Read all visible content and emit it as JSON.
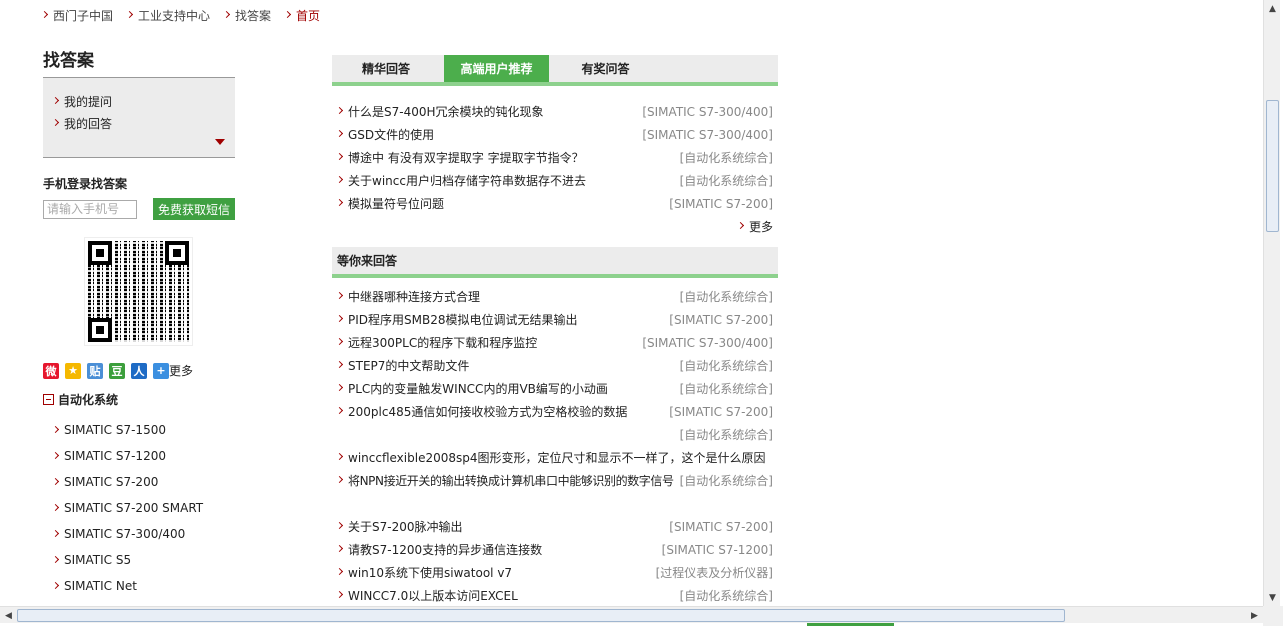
{
  "breadcrumb": [
    "西门子中国",
    "工业支持中心",
    "找答案",
    "首页"
  ],
  "left": {
    "title": "找答案",
    "my_links": [
      "我的提问",
      "我的回答"
    ],
    "mobile_title": "手机登录找答案",
    "phone_placeholder": "请输入手机号",
    "sms_button": "免费获取短信",
    "share_more": "更多",
    "category_title": "自动化系统",
    "categories": [
      "SIMATIC S7-1500",
      "SIMATIC S7-1200",
      "SIMATIC S7-200",
      "SIMATIC S7-200 SMART",
      "SIMATIC S7-300/400",
      "SIMATIC S5",
      "SIMATIC Net"
    ]
  },
  "tabs": [
    "精华回答",
    "高端用户推荐",
    "有奖问答"
  ],
  "featured": [
    {
      "q": "什么是S7-400H冗余模块的钝化现象",
      "c": "[SIMATIC S7-300/400]"
    },
    {
      "q": "GSD文件的使用",
      "c": "[SIMATIC S7-300/400]"
    },
    {
      "q": "博途中  有没有双字提取字  字提取字节指令？",
      "c": "[自动化系统综合]"
    },
    {
      "q": "关于wincc用户归档存储字符串数据存不进去",
      "c": "[自动化系统综合]"
    },
    {
      "q": "模拟量符号位问题",
      "c": "[SIMATIC S7-200]"
    }
  ],
  "more_label": "更多",
  "wait_title": "等你来回答",
  "waiting": [
    {
      "q": "中继器哪种连接方式合理",
      "c": "[自动化系统综合]"
    },
    {
      "q": "PID程序用SMB28模拟电位调试无结果输出",
      "c": "[SIMATIC S7-200]"
    },
    {
      "q": "远程300PLC的程序下载和程序监控",
      "c": "[SIMATIC S7-300/400]"
    },
    {
      "q": "STEP7的中文帮助文件",
      "c": "[自动化系统综合]"
    },
    {
      "q": "PLC内的变量触发WINCC内的用VB编写的小动画",
      "c": "[自动化系统综合]"
    },
    {
      "q": "200plc485通信如何接收校验方式为空格校验的数据",
      "c": "[SIMATIC S7-200]"
    },
    {
      "q": "",
      "c": "[自动化系统综合]"
    },
    {
      "q": "winccflexible2008sp4图形变形，定位尺寸和显示不一样了，这个是什么原因",
      "c": ""
    },
    {
      "q": "将NPN接近开关的输出转换成计算机串口中能够识别的数字信号",
      "c": "[自动化系统综合]"
    }
  ],
  "recent": [
    {
      "q": "关于S7-200脉冲输出",
      "c": "[SIMATIC S7-200]"
    },
    {
      "q": "请教S7-1200支持的异步通信连接数",
      "c": "[SIMATIC S7-1200]"
    },
    {
      "q": "win10系统下使用siwatool v7",
      "c": "[过程仪表及分析仪器]"
    },
    {
      "q": "WINCC7.0以上版本访问EXCEL",
      "c": "[自动化系统综合]"
    }
  ]
}
